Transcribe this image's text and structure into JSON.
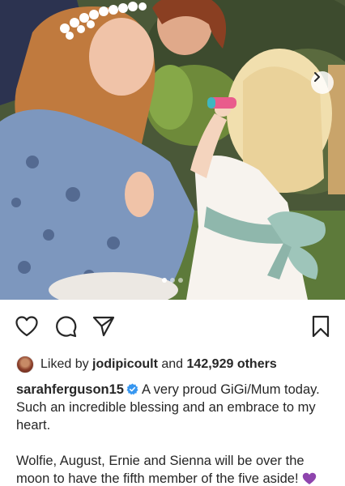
{
  "post": {
    "photo": {
      "alt_icon": "next-arrow-icon",
      "carousel_count": 3,
      "carousel_active": 0
    },
    "actions": {
      "like_icon": "heart-icon",
      "comment_icon": "comment-icon",
      "share_icon": "paper-plane-icon",
      "save_icon": "bookmark-icon"
    },
    "likes": {
      "prefix": "Liked by",
      "user": "jodipicoult",
      "connector": "and",
      "count": "142,929 others"
    },
    "caption": {
      "username": "sarahferguson15",
      "line1": "A very proud GiGi/Mum today. Such an incredible blessing and an embrace to my heart.",
      "line2": "Wolfie, August, Ernie and Sienna will be over the moon to have the fifth member of the five aside!"
    },
    "colors": {
      "text": "#262626",
      "verified": "#3897f0",
      "emoji_heart": "#8e44ad"
    }
  }
}
